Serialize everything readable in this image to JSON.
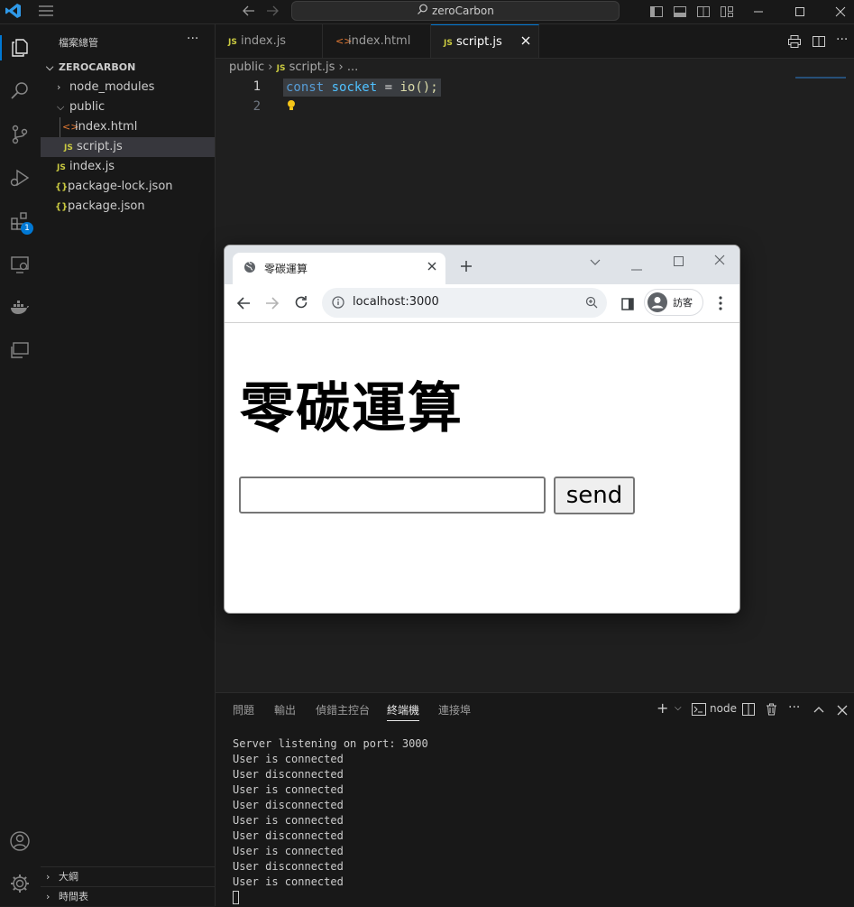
{
  "titlebar": {
    "search": "zeroCarbon"
  },
  "activity_bar": {
    "extensions_badge": "1"
  },
  "sidebar": {
    "header": "檔案總管",
    "more": "···",
    "root": "ZEROCARBON",
    "items": [
      {
        "label": "node_modules",
        "type": "folder",
        "expanded": false
      },
      {
        "label": "public",
        "type": "folder",
        "expanded": true
      },
      {
        "label": "index.html",
        "type": "html"
      },
      {
        "label": "script.js",
        "type": "js"
      },
      {
        "label": "index.js",
        "type": "js"
      },
      {
        "label": "package-lock.json",
        "type": "json"
      },
      {
        "label": "package.json",
        "type": "json"
      }
    ],
    "outline": "大綱",
    "timeline": "時間表"
  },
  "tabs": [
    {
      "label": "index.js",
      "icon": "JS"
    },
    {
      "label": "index.html",
      "icon": "<>"
    },
    {
      "label": "script.js",
      "icon": "JS",
      "active": true
    }
  ],
  "editor": {
    "breadcrumb": {
      "folder": "public",
      "file": "script.js",
      "more": "..."
    },
    "lines": [
      "1",
      "2"
    ],
    "code": {
      "kw": "const",
      "var": "socket",
      "op": "=",
      "fn": "io",
      "rest": "();"
    }
  },
  "panel": {
    "tabs": [
      "問題",
      "輸出",
      "偵錯主控台",
      "終端機",
      "連接埠"
    ],
    "active_tab": "終端機",
    "terminal_name": "node",
    "lines": [
      "Server listening on port: 3000",
      "User is connected",
      "User disconnected",
      "User is connected",
      "User disconnected",
      "User is connected",
      "User disconnected",
      "User is connected",
      "User disconnected",
      "User is connected"
    ]
  },
  "browser": {
    "tab_title": "零碳運算",
    "url": "localhost:3000",
    "profile": "訪客",
    "page_title": "零碳運算",
    "input_value": "",
    "send_label": "send"
  },
  "colors": {
    "accent": "#0078d4",
    "badge": "#0078d4",
    "code_kw": "#569cd6",
    "code_var": "#4fc1ff",
    "code_fn": "#dcdcaa"
  }
}
